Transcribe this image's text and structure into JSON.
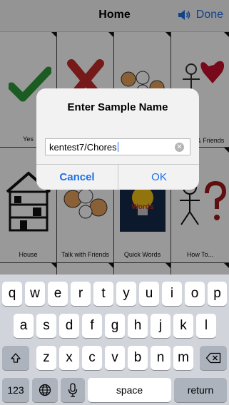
{
  "navbar": {
    "title": "Home",
    "done_label": "Done"
  },
  "tiles": [
    {
      "label": "Yes",
      "icon": "check-icon"
    },
    {
      "label": "",
      "icon": "x-icon"
    },
    {
      "label": "",
      "icon": "talk-icon"
    },
    {
      "label": "Family & Friends",
      "icon": "family-icon"
    },
    {
      "label": "House",
      "icon": "house-icon"
    },
    {
      "label": "Talk with Friends",
      "icon": "talk-icon"
    },
    {
      "label": "Quick Words",
      "icon": "lightbulb-icon"
    },
    {
      "label": "How To...",
      "icon": "question-icon"
    }
  ],
  "tile_text": {
    "quick_words_badge": "Words"
  },
  "alert": {
    "title": "Enter Sample Name",
    "input_value": "kentest7/Chores",
    "cancel_label": "Cancel",
    "ok_label": "OK"
  },
  "keyboard": {
    "row1": [
      "q",
      "w",
      "e",
      "r",
      "t",
      "y",
      "u",
      "i",
      "o",
      "p"
    ],
    "row2": [
      "a",
      "s",
      "d",
      "f",
      "g",
      "h",
      "j",
      "k",
      "l"
    ],
    "row3": [
      "z",
      "x",
      "c",
      "v",
      "b",
      "n",
      "m"
    ],
    "numbers_label": "123",
    "space_label": "space",
    "return_label": "return"
  },
  "colors": {
    "accent": "#1e6fe6",
    "check": "#2f9a3a",
    "cross": "#c42a2a",
    "heart": "#c8102e"
  }
}
